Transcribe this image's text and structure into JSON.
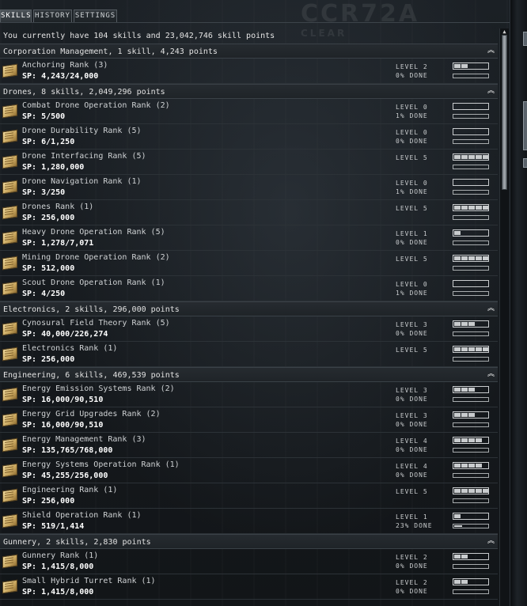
{
  "window": {
    "background_mark": "CCR72A",
    "background_sub": "CLEAR"
  },
  "tabs": [
    {
      "label": "SKILLS",
      "active": true
    },
    {
      "label": "HISTORY",
      "active": false
    },
    {
      "label": "SETTINGS",
      "active": false
    }
  ],
  "summary": "You currently have 104 skills and 23,042,746 skill points",
  "groups": [
    {
      "header": "Corporation Management, 1 skill, 4,243 points",
      "skills": [
        {
          "name": "Anchoring Rank (3)",
          "sp": "SP: 4,243/24,000",
          "level_text": "LEVEL 2",
          "progress_text": "0% DONE",
          "level": 2,
          "progress": 0
        }
      ]
    },
    {
      "header": "Drones, 8 skills, 2,049,296 points",
      "skills": [
        {
          "name": "Combat Drone Operation Rank (2)",
          "sp": "SP: 5/500",
          "level_text": "LEVEL 0",
          "progress_text": "1% DONE",
          "level": 0,
          "progress": 0.01
        },
        {
          "name": "Drone Durability Rank (5)",
          "sp": "SP: 6/1,250",
          "level_text": "LEVEL 0",
          "progress_text": "0% DONE",
          "level": 0,
          "progress": 0
        },
        {
          "name": "Drone Interfacing Rank (5)",
          "sp": "SP: 1,280,000",
          "level_text": "LEVEL 5",
          "progress_text": "",
          "level": 5,
          "progress": 0
        },
        {
          "name": "Drone Navigation Rank (1)",
          "sp": "SP: 3/250",
          "level_text": "LEVEL 0",
          "progress_text": "1% DONE",
          "level": 0,
          "progress": 0.01
        },
        {
          "name": "Drones Rank (1)",
          "sp": "SP: 256,000",
          "level_text": "LEVEL 5",
          "progress_text": "",
          "level": 5,
          "progress": 0
        },
        {
          "name": "Heavy Drone Operation Rank (5)",
          "sp": "SP: 1,278/7,071",
          "level_text": "LEVEL 1",
          "progress_text": "0% DONE",
          "level": 1,
          "progress": 0
        },
        {
          "name": "Mining Drone Operation Rank (2)",
          "sp": "SP: 512,000",
          "level_text": "LEVEL 5",
          "progress_text": "",
          "level": 5,
          "progress": 0
        },
        {
          "name": "Scout Drone Operation Rank (1)",
          "sp": "SP: 4/250",
          "level_text": "LEVEL 0",
          "progress_text": "1% DONE",
          "level": 0,
          "progress": 0.01
        }
      ]
    },
    {
      "header": "Electronics, 2 skills, 296,000 points",
      "skills": [
        {
          "name": "Cynosural Field Theory Rank (5)",
          "sp": "SP: 40,000/226,274",
          "level_text": "LEVEL 3",
          "progress_text": "0% DONE",
          "level": 3,
          "progress": 0
        },
        {
          "name": "Electronics Rank (1)",
          "sp": "SP: 256,000",
          "level_text": "LEVEL 5",
          "progress_text": "",
          "level": 5,
          "progress": 0
        }
      ]
    },
    {
      "header": "Engineering, 6 skills, 469,539 points",
      "skills": [
        {
          "name": "Energy Emission Systems Rank (2)",
          "sp": "SP: 16,000/90,510",
          "level_text": "LEVEL 3",
          "progress_text": "0% DONE",
          "level": 3,
          "progress": 0
        },
        {
          "name": "Energy Grid Upgrades Rank (2)",
          "sp": "SP: 16,000/90,510",
          "level_text": "LEVEL 3",
          "progress_text": "0% DONE",
          "level": 3,
          "progress": 0
        },
        {
          "name": "Energy Management Rank (3)",
          "sp": "SP: 135,765/768,000",
          "level_text": "LEVEL 4",
          "progress_text": "0% DONE",
          "level": 4,
          "progress": 0
        },
        {
          "name": "Energy Systems Operation Rank (1)",
          "sp": "SP: 45,255/256,000",
          "level_text": "LEVEL 4",
          "progress_text": "0% DONE",
          "level": 4,
          "progress": 0
        },
        {
          "name": "Engineering Rank (1)",
          "sp": "SP: 256,000",
          "level_text": "LEVEL 5",
          "progress_text": "",
          "level": 5,
          "progress": 0
        },
        {
          "name": "Shield Operation Rank (1)",
          "sp": "SP: 519/1,414",
          "level_text": "LEVEL 1",
          "progress_text": "23% DONE",
          "level": 1,
          "progress": 0.23
        }
      ]
    },
    {
      "header": "Gunnery, 2 skills, 2,830 points",
      "skills": [
        {
          "name": "Gunnery Rank (1)",
          "sp": "SP: 1,415/8,000",
          "level_text": "LEVEL 2",
          "progress_text": "0% DONE",
          "level": 2,
          "progress": 0
        },
        {
          "name": "Small Hybrid Turret Rank (1)",
          "sp": "SP: 1,415/8,000",
          "level_text": "LEVEL 2",
          "progress_text": "0% DONE",
          "level": 2,
          "progress": 0
        }
      ]
    }
  ],
  "icons": {
    "book": "skillbook-icon",
    "collapse": "collapse-chevron-icon",
    "scroll_up": "scroll-up-icon"
  }
}
